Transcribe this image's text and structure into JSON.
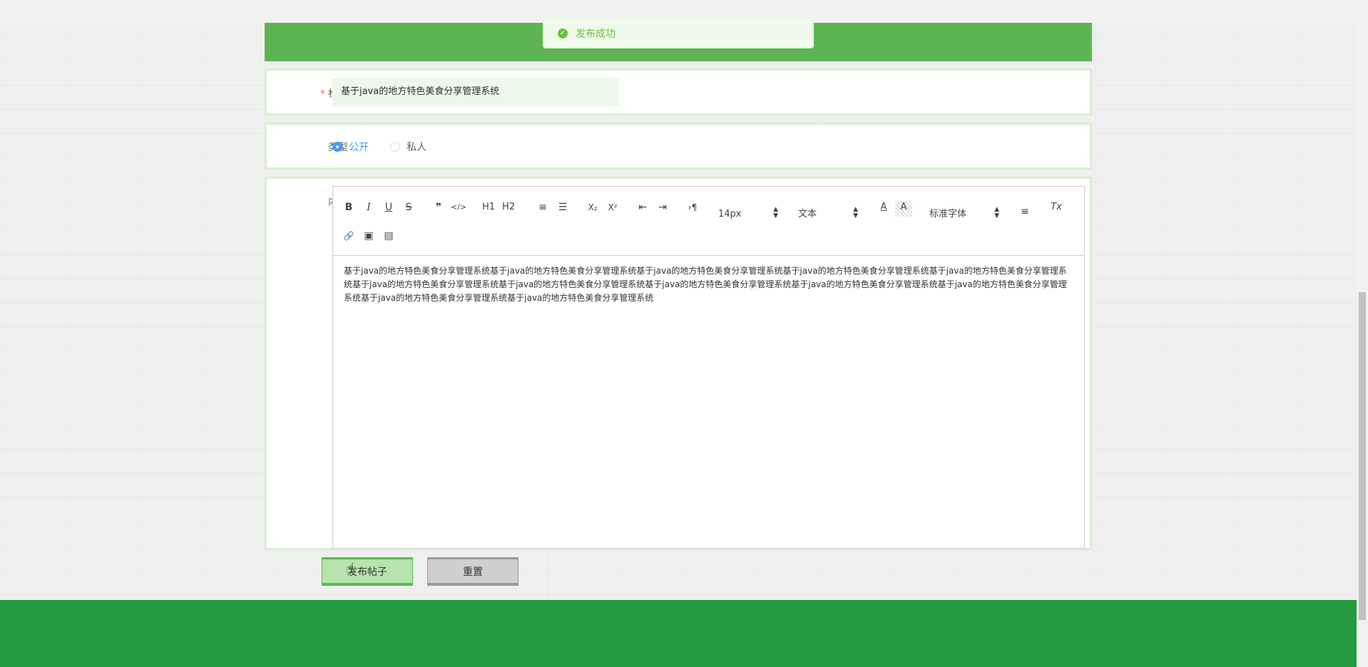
{
  "toast": {
    "icon": "check-circle-icon",
    "message": "发布成功"
  },
  "form": {
    "title": {
      "required_mark": "*",
      "label": "标题",
      "value": "基于java的地方特色美食分享管理系统"
    },
    "type": {
      "label": "类型",
      "options": [
        {
          "label": "公开",
          "checked": true
        },
        {
          "label": "私人",
          "checked": false
        }
      ]
    },
    "content": {
      "label": "内容",
      "toolbar": {
        "bold": "B",
        "italic": "I",
        "underline": "U",
        "strike": "S",
        "blockquote": "❞",
        "code": "</>",
        "h1": "H1",
        "h2": "H2",
        "ordered_list": "≡",
        "bullet_list": "☰",
        "subscript": "X₂",
        "superscript": "X²",
        "outdent": "⇤",
        "indent": "⇥",
        "direction": "›¶",
        "size": "14px",
        "header": "文本",
        "color": "A",
        "background": "A",
        "font": "标准字体",
        "align": "≡",
        "clean": "Tx",
        "link": "🔗",
        "image": "▣",
        "video": "▤"
      },
      "text": "基于java的地方特色美食分享管理系统基于java的地方特色美食分享管理系统基于java的地方特色美食分享管理系统基于java的地方特色美食分享管理系统基于java的地方特色美食分享管理系统基于java的地方特色美食分享管理系统基于java的地方特色美食分享管理系统基于java的地方特色美食分享管理系统基于java的地方特色美食分享管理系统基于java的地方特色美食分享管理系统基于java的地方特色美食分享管理系统基于java的地方特色美食分享管理系统"
    }
  },
  "actions": {
    "submit": "发布帖子",
    "reset": "重置"
  },
  "colors": {
    "header_green": "#5cb552",
    "footer_green": "#259b3f",
    "accent_blue": "#409eff",
    "success": "#67c23a"
  }
}
